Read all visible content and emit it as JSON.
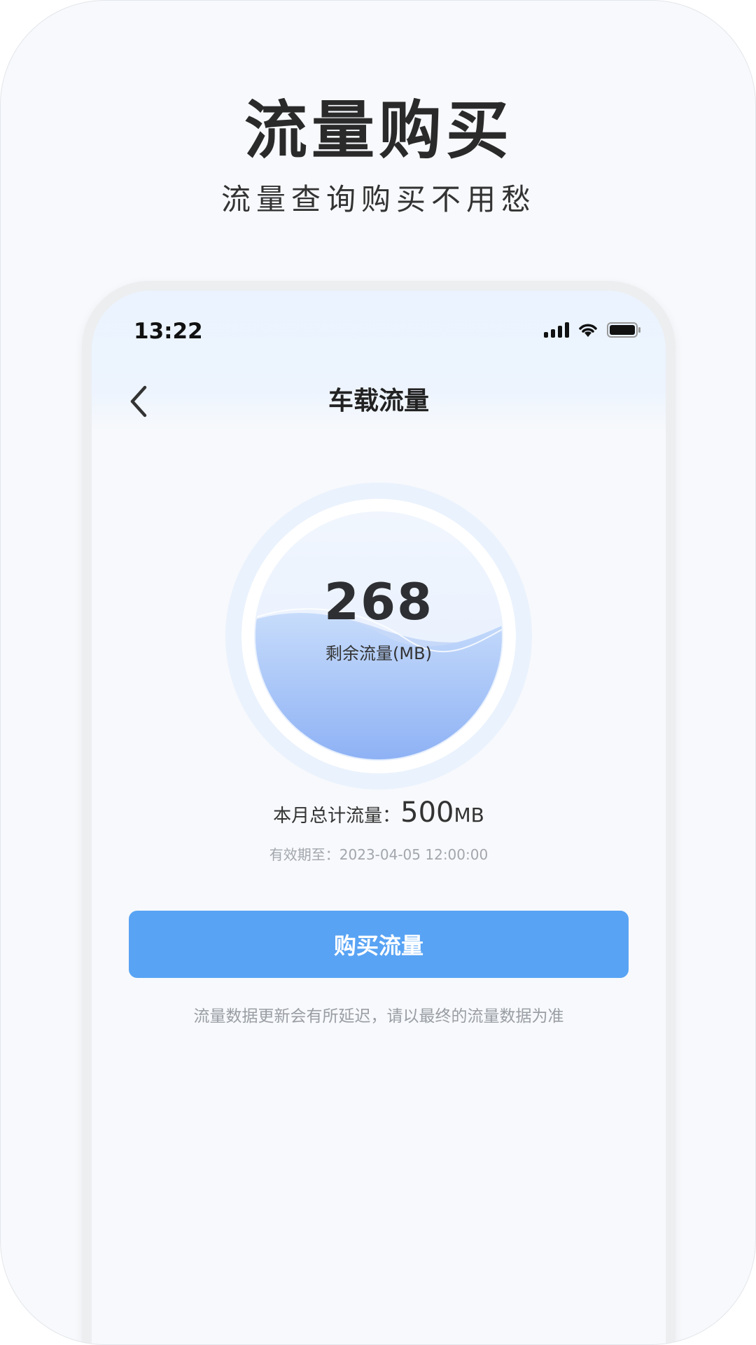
{
  "promo": {
    "title": "流量购买",
    "subtitle": "流量查询购买不用愁"
  },
  "status_bar": {
    "time": "13:22",
    "icons": [
      "signal-icon",
      "wifi-icon",
      "battery-icon"
    ]
  },
  "nav": {
    "title": "车载流量",
    "back_icon": "chevron-left-icon"
  },
  "gauge": {
    "value": "268",
    "label": "剩余流量(MB)",
    "remaining_fraction": 0.536
  },
  "usage": {
    "total_label": "本月总计流量：",
    "total_value": "500",
    "total_unit": "MB",
    "expiry": "有效期至：2023-04-05 12:00:00"
  },
  "actions": {
    "buy_label": "购买流量"
  },
  "footnote": "流量数据更新会有所延迟，请以最终的流量数据为准",
  "colors": {
    "accent": "#58a3f4",
    "water_top": "#c2d8fb",
    "water_bottom": "#8db1f5",
    "page_bg": "#f7f9fc"
  }
}
